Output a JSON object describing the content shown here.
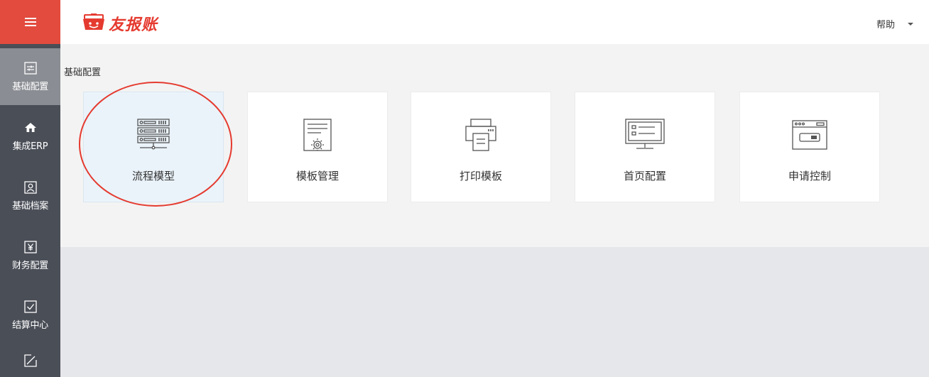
{
  "header": {
    "logo_text": "友报账",
    "help_label": "帮助"
  },
  "sidebar": {
    "items": [
      {
        "label": "基础配置",
        "icon": "sliders-icon"
      },
      {
        "label": "集成ERP",
        "icon": "home-icon"
      },
      {
        "label": "基础档案",
        "icon": "person-card-icon"
      },
      {
        "label": "财务配置",
        "icon": "yen-icon"
      },
      {
        "label": "结算中心",
        "icon": "checkbox-icon"
      },
      {
        "label": "",
        "icon": "edit-icon"
      }
    ]
  },
  "main": {
    "section_title": "基础配置",
    "cards": [
      {
        "label": "流程模型",
        "icon": "server-icon"
      },
      {
        "label": "模板管理",
        "icon": "template-gear-icon"
      },
      {
        "label": "打印模板",
        "icon": "printer-icon"
      },
      {
        "label": "首页配置",
        "icon": "monitor-icon"
      },
      {
        "label": "申请控制",
        "icon": "window-toggle-icon"
      }
    ]
  },
  "colors": {
    "accent": "#e24b3e",
    "sidebar": "#4a4e57",
    "sidebar_active": "#8a8d93",
    "selected_card": "#eaf3fa"
  }
}
